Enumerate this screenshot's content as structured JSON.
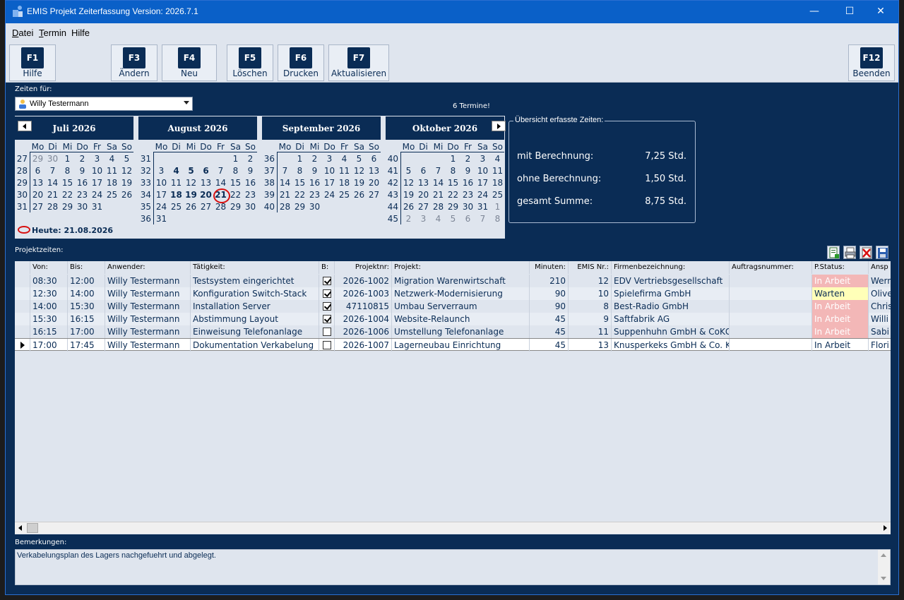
{
  "window": {
    "title": "EMIS Projekt Zeiterfassung Version: 2026.7.1",
    "minimize": "—",
    "maximize": "☐",
    "close": "✕"
  },
  "menu": {
    "datei_u": "D",
    "datei_rest": "atei",
    "termin_u": "T",
    "termin_rest": "ermin",
    "hilfe": "Hilfe"
  },
  "toolbar": {
    "f1_key": "F1",
    "f1_label": "Hilfe",
    "f3_key": "F3",
    "f3_label": "Ändern",
    "f4_key": "F4",
    "f4_label": "Neu",
    "f5_key": "F5",
    "f5_label": "Löschen",
    "f6_key": "F6",
    "f6_label": "Drucken",
    "f7_key": "F7",
    "f7_label": "Aktualisieren",
    "f12_key": "F12",
    "f12_label": "Beenden"
  },
  "zeiten_fuer": {
    "label": "Zeiten für:",
    "value": "Willy Testermann"
  },
  "termine_count": "6 Termine!",
  "calendar": {
    "today_text": "Heute: 21.08.2026",
    "weekdays": [
      "Mo",
      "Di",
      "Mi",
      "Do",
      "Fr",
      "Sa",
      "So"
    ],
    "months": [
      {
        "title": "Juli 2026",
        "weeks": [
          "27",
          "28",
          "29",
          "30",
          "31"
        ],
        "rows": [
          [
            [
              "29",
              "o"
            ],
            [
              "30",
              "o"
            ],
            [
              "1",
              ""
            ],
            [
              "2",
              ""
            ],
            [
              "3",
              ""
            ],
            [
              "4",
              ""
            ],
            [
              "5",
              ""
            ]
          ],
          [
            [
              "6",
              ""
            ],
            [
              "7",
              ""
            ],
            [
              "8",
              ""
            ],
            [
              "9",
              ""
            ],
            [
              "10",
              ""
            ],
            [
              "11",
              ""
            ],
            [
              "12",
              ""
            ]
          ],
          [
            [
              "13",
              ""
            ],
            [
              "14",
              ""
            ],
            [
              "15",
              ""
            ],
            [
              "16",
              ""
            ],
            [
              "17",
              ""
            ],
            [
              "18",
              ""
            ],
            [
              "19",
              ""
            ]
          ],
          [
            [
              "20",
              ""
            ],
            [
              "21",
              ""
            ],
            [
              "22",
              ""
            ],
            [
              "23",
              ""
            ],
            [
              "24",
              ""
            ],
            [
              "25",
              ""
            ],
            [
              "26",
              ""
            ]
          ],
          [
            [
              "27",
              ""
            ],
            [
              "28",
              ""
            ],
            [
              "29",
              ""
            ],
            [
              "30",
              ""
            ],
            [
              "31",
              ""
            ],
            [
              "",
              ""
            ],
            [
              "",
              ""
            ]
          ]
        ]
      },
      {
        "title": "August 2026",
        "weeks": [
          "31",
          "32",
          "33",
          "34",
          "35",
          "36"
        ],
        "rows": [
          [
            [
              "",
              ""
            ],
            [
              "",
              ""
            ],
            [
              "",
              ""
            ],
            [
              "",
              ""
            ],
            [
              "",
              ""
            ],
            [
              "1",
              ""
            ],
            [
              "2",
              ""
            ]
          ],
          [
            [
              "3",
              ""
            ],
            [
              "4",
              "b"
            ],
            [
              "5",
              "b"
            ],
            [
              "6",
              "b"
            ],
            [
              "7",
              ""
            ],
            [
              "8",
              ""
            ],
            [
              "9",
              ""
            ]
          ],
          [
            [
              "10",
              ""
            ],
            [
              "11",
              ""
            ],
            [
              "12",
              ""
            ],
            [
              "13",
              ""
            ],
            [
              "14",
              ""
            ],
            [
              "15",
              ""
            ],
            [
              "16",
              ""
            ]
          ],
          [
            [
              "17",
              ""
            ],
            [
              "18",
              "b"
            ],
            [
              "19",
              "b"
            ],
            [
              "20",
              "b"
            ],
            [
              "21",
              "t"
            ],
            [
              "22",
              ""
            ],
            [
              "23",
              ""
            ]
          ],
          [
            [
              "24",
              ""
            ],
            [
              "25",
              ""
            ],
            [
              "26",
              ""
            ],
            [
              "27",
              ""
            ],
            [
              "28",
              ""
            ],
            [
              "29",
              ""
            ],
            [
              "30",
              ""
            ]
          ],
          [
            [
              "31",
              ""
            ],
            [
              "",
              ""
            ],
            [
              "",
              ""
            ],
            [
              "",
              ""
            ],
            [
              "",
              ""
            ],
            [
              "",
              ""
            ],
            [
              "",
              ""
            ]
          ]
        ]
      },
      {
        "title": "September 2026",
        "weeks": [
          "36",
          "37",
          "38",
          "39",
          "40"
        ],
        "rows": [
          [
            [
              "",
              ""
            ],
            [
              "1",
              ""
            ],
            [
              "2",
              ""
            ],
            [
              "3",
              ""
            ],
            [
              "4",
              ""
            ],
            [
              "5",
              ""
            ],
            [
              "6",
              ""
            ]
          ],
          [
            [
              "7",
              ""
            ],
            [
              "8",
              ""
            ],
            [
              "9",
              ""
            ],
            [
              "10",
              ""
            ],
            [
              "11",
              ""
            ],
            [
              "12",
              ""
            ],
            [
              "13",
              ""
            ]
          ],
          [
            [
              "14",
              ""
            ],
            [
              "15",
              ""
            ],
            [
              "16",
              ""
            ],
            [
              "17",
              ""
            ],
            [
              "18",
              ""
            ],
            [
              "19",
              ""
            ],
            [
              "20",
              ""
            ]
          ],
          [
            [
              "21",
              ""
            ],
            [
              "22",
              ""
            ],
            [
              "23",
              ""
            ],
            [
              "24",
              ""
            ],
            [
              "25",
              ""
            ],
            [
              "26",
              ""
            ],
            [
              "27",
              ""
            ]
          ],
          [
            [
              "28",
              ""
            ],
            [
              "29",
              ""
            ],
            [
              "30",
              ""
            ],
            [
              "",
              ""
            ],
            [
              "",
              ""
            ],
            [
              "",
              ""
            ],
            [
              "",
              ""
            ]
          ]
        ]
      },
      {
        "title": "Oktober 2026",
        "weeks": [
          "40",
          "41",
          "42",
          "43",
          "44",
          "45"
        ],
        "rows": [
          [
            [
              "",
              ""
            ],
            [
              "",
              ""
            ],
            [
              "",
              ""
            ],
            [
              "1",
              ""
            ],
            [
              "2",
              ""
            ],
            [
              "3",
              ""
            ],
            [
              "4",
              ""
            ]
          ],
          [
            [
              "5",
              ""
            ],
            [
              "6",
              ""
            ],
            [
              "7",
              ""
            ],
            [
              "8",
              ""
            ],
            [
              "9",
              ""
            ],
            [
              "10",
              ""
            ],
            [
              "11",
              ""
            ]
          ],
          [
            [
              "12",
              ""
            ],
            [
              "13",
              ""
            ],
            [
              "14",
              ""
            ],
            [
              "15",
              ""
            ],
            [
              "16",
              ""
            ],
            [
              "17",
              ""
            ],
            [
              "18",
              ""
            ]
          ],
          [
            [
              "19",
              ""
            ],
            [
              "20",
              ""
            ],
            [
              "21",
              ""
            ],
            [
              "22",
              ""
            ],
            [
              "23",
              ""
            ],
            [
              "24",
              ""
            ],
            [
              "25",
              ""
            ]
          ],
          [
            [
              "26",
              ""
            ],
            [
              "27",
              ""
            ],
            [
              "28",
              ""
            ],
            [
              "29",
              ""
            ],
            [
              "30",
              ""
            ],
            [
              "31",
              ""
            ],
            [
              "1",
              "o"
            ]
          ],
          [
            [
              "2",
              "o"
            ],
            [
              "3",
              "o"
            ],
            [
              "4",
              "o"
            ],
            [
              "5",
              "o"
            ],
            [
              "6",
              "o"
            ],
            [
              "7",
              "o"
            ],
            [
              "8",
              "o"
            ]
          ]
        ]
      }
    ]
  },
  "summary": {
    "legend": "Übersicht erfasste Zeiten:",
    "mit_label": "mit Berechnung:",
    "mit_value": "7,25 Std.",
    "ohne_label": "ohne Berechnung:",
    "ohne_value": "1,50 Std.",
    "gesamt_label": "gesamt Summe:",
    "gesamt_value": "8,75 Std."
  },
  "projektzeiten_label": "Projektzeiten:",
  "table": {
    "headers": [
      "Von:",
      "Bis:",
      "Anwender:",
      "Tätigkeit:",
      "B:",
      "Projektnr:",
      "Projekt:",
      "Minuten:",
      "EMIS Nr.:",
      "Firmenbezeichnung:",
      "Auftragsnummer:",
      "P.Status:",
      "Ansp"
    ],
    "rows": [
      {
        "von": "08:30",
        "bis": "12:00",
        "anwender": "Willy Testermann",
        "taetigkeit": "Testsystem eingerichtet",
        "b": true,
        "projektnr": "2026-1002",
        "projekt": "Migration Warenwirtschaft",
        "minuten": "210",
        "emis": "12",
        "firma": "EDV Vertriebsgesellschaft",
        "auftrag": "",
        "status": "In Arbeit",
        "status_kind": "arbeit",
        "ansp": "Wern"
      },
      {
        "von": "12:30",
        "bis": "14:00",
        "anwender": "Willy Testermann",
        "taetigkeit": "Konfiguration Switch-Stack",
        "b": true,
        "projektnr": "2026-1003",
        "projekt": "Netzwerk-Modernisierung",
        "minuten": "90",
        "emis": "10",
        "firma": "Spielefirma GmbH",
        "auftrag": "",
        "status": "Warten",
        "status_kind": "warten",
        "ansp": "Olive"
      },
      {
        "von": "14:00",
        "bis": "15:30",
        "anwender": "Willy Testermann",
        "taetigkeit": "Installation Server",
        "b": true,
        "projektnr": "47110815",
        "projekt": "Umbau Serverraum",
        "minuten": "90",
        "emis": "8",
        "firma": "Best-Radio GmbH",
        "auftrag": "",
        "status": "In Arbeit",
        "status_kind": "arbeit",
        "ansp": "Chris"
      },
      {
        "von": "15:30",
        "bis": "16:15",
        "anwender": "Willy Testermann",
        "taetigkeit": "Abstimmung Layout",
        "b": true,
        "projektnr": "2026-1004",
        "projekt": "Website-Relaunch",
        "minuten": "45",
        "emis": "9",
        "firma": "Saftfabrik AG",
        "auftrag": "",
        "status": "In Arbeit",
        "status_kind": "arbeit",
        "ansp": "Willi"
      },
      {
        "von": "16:15",
        "bis": "17:00",
        "anwender": "Willy Testermann",
        "taetigkeit": "Einweisung Telefonanlage",
        "b": false,
        "projektnr": "2026-1006",
        "projekt": "Umstellung Telefonanlage",
        "minuten": "45",
        "emis": "11",
        "firma": "Suppenhuhn GmbH & CoKG",
        "auftrag": "",
        "status": "In Arbeit",
        "status_kind": "arbeit",
        "ansp": "Sabi"
      },
      {
        "von": "17:00",
        "bis": "17:45",
        "anwender": "Willy Testermann",
        "taetigkeit": "Dokumentation Verkabelung",
        "b": false,
        "projektnr": "2026-1007",
        "projekt": "Lagerneubau Einrichtung",
        "minuten": "45",
        "emis": "13",
        "firma": "Knusperkeks GmbH & Co. KG",
        "auftrag": "",
        "status": "In Arbeit",
        "status_kind": "plain",
        "ansp": "Flori"
      }
    ]
  },
  "bemerkungen": {
    "label": "Bemerkungen:",
    "text": "Verkabelungsplan des Lagers nachgefuehrt und abgelegt."
  },
  "colors": {
    "navy": "#0a2c55",
    "titlebar": "#0a60c8",
    "panel": "#dfe5ee",
    "status_arbeit": "#f3b7b7",
    "status_warten": "#ffffb8",
    "today_ring": "#d81010"
  },
  "icons": [
    "app-icon",
    "user-icon",
    "new-entry-icon",
    "print-icon",
    "delete-icon",
    "save-icon"
  ]
}
